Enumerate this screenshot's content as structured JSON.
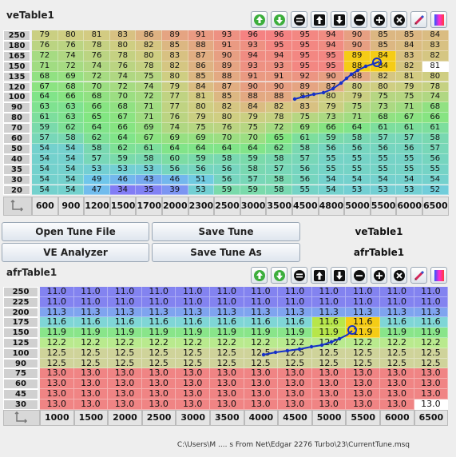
{
  "ve": {
    "title": "veTable1",
    "rpm": [
      "600",
      "900",
      "1200",
      "1500",
      "1700",
      "2000",
      "2300",
      "2500",
      "3000",
      "3500",
      "4500",
      "4800",
      "5000",
      "5500",
      "6000",
      "6500"
    ],
    "load": [
      "250",
      "180",
      "165",
      "150",
      "135",
      "120",
      "100",
      "90",
      "80",
      "70",
      "60",
      "50",
      "40",
      "35",
      "30",
      "20"
    ],
    "rows": [
      [
        "79",
        "80",
        "81",
        "83",
        "86",
        "89",
        "91",
        "93",
        "96",
        "96",
        "95",
        "94",
        "90",
        "85",
        "85",
        "84"
      ],
      [
        "76",
        "76",
        "78",
        "80",
        "82",
        "85",
        "88",
        "91",
        "93",
        "95",
        "95",
        "94",
        "90",
        "85",
        "84",
        "83"
      ],
      [
        "72",
        "74",
        "76",
        "78",
        "80",
        "83",
        "87",
        "90",
        "94",
        "94",
        "95",
        "95",
        "89",
        "84",
        "83",
        "82"
      ],
      [
        "71",
        "72",
        "74",
        "76",
        "78",
        "82",
        "86",
        "89",
        "93",
        "93",
        "95",
        "95",
        "88",
        "84",
        "82",
        "81"
      ],
      [
        "68",
        "69",
        "72",
        "74",
        "75",
        "80",
        "85",
        "88",
        "91",
        "91",
        "92",
        "90",
        "88",
        "82",
        "81",
        "80"
      ],
      [
        "67",
        "68",
        "70",
        "72",
        "74",
        "79",
        "84",
        "87",
        "90",
        "90",
        "89",
        "87",
        "80",
        "80",
        "79",
        "78"
      ],
      [
        "64",
        "66",
        "68",
        "70",
        "72",
        "77",
        "81",
        "85",
        "88",
        "88",
        "83",
        "80",
        "79",
        "75",
        "75",
        "74"
      ],
      [
        "63",
        "63",
        "66",
        "68",
        "71",
        "77",
        "80",
        "82",
        "84",
        "82",
        "83",
        "79",
        "75",
        "73",
        "71",
        "68"
      ],
      [
        "61",
        "63",
        "65",
        "67",
        "71",
        "76",
        "79",
        "80",
        "79",
        "78",
        "75",
        "73",
        "71",
        "68",
        "67",
        "66"
      ],
      [
        "59",
        "62",
        "64",
        "66",
        "69",
        "74",
        "75",
        "76",
        "75",
        "72",
        "69",
        "66",
        "64",
        "61",
        "61",
        "61"
      ],
      [
        "57",
        "58",
        "62",
        "64",
        "67",
        "69",
        "69",
        "70",
        "70",
        "65",
        "61",
        "59",
        "58",
        "57",
        "57",
        "58"
      ],
      [
        "54",
        "54",
        "58",
        "62",
        "61",
        "64",
        "64",
        "64",
        "64",
        "62",
        "58",
        "56",
        "56",
        "56",
        "56",
        "57"
      ],
      [
        "54",
        "54",
        "57",
        "59",
        "58",
        "60",
        "59",
        "58",
        "59",
        "58",
        "57",
        "55",
        "55",
        "55",
        "55",
        "56"
      ],
      [
        "54",
        "54",
        "53",
        "53",
        "53",
        "56",
        "56",
        "56",
        "58",
        "57",
        "56",
        "55",
        "55",
        "55",
        "55",
        "55"
      ],
      [
        "54",
        "54",
        "49",
        "46",
        "43",
        "46",
        "51",
        "56",
        "57",
        "58",
        "56",
        "54",
        "54",
        "54",
        "54",
        "54"
      ],
      [
        "54",
        "54",
        "47",
        "34",
        "35",
        "39",
        "53",
        "59",
        "59",
        "58",
        "55",
        "54",
        "53",
        "53",
        "53",
        "52"
      ]
    ]
  },
  "afr": {
    "title": "afrTable1",
    "rpm": [
      "1000",
      "1500",
      "2000",
      "2500",
      "3000",
      "3500",
      "4000",
      "4500",
      "5000",
      "5500",
      "6000",
      "6500"
    ],
    "load": [
      "250",
      "225",
      "200",
      "175",
      "150",
      "125",
      "100",
      "90",
      "75",
      "60",
      "45",
      "30"
    ],
    "rows": [
      [
        "11.0",
        "11.0",
        "11.0",
        "11.0",
        "11.0",
        "11.0",
        "11.0",
        "11.0",
        "11.0",
        "11.0",
        "11.0",
        "11.0"
      ],
      [
        "11.0",
        "11.0",
        "11.0",
        "11.0",
        "11.0",
        "11.0",
        "11.0",
        "11.0",
        "11.0",
        "11.0",
        "11.0",
        "11.0"
      ],
      [
        "11.3",
        "11.3",
        "11.3",
        "11.3",
        "11.3",
        "11.3",
        "11.3",
        "11.3",
        "11.3",
        "11.3",
        "11.3",
        "11.3"
      ],
      [
        "11.6",
        "11.6",
        "11.6",
        "11.6",
        "11.6",
        "11.6",
        "11.6",
        "11.6",
        "11.6",
        "11.6",
        "11.6",
        "11.6"
      ],
      [
        "11.9",
        "11.9",
        "11.9",
        "11.9",
        "11.9",
        "11.9",
        "11.9",
        "11.9",
        "11.9",
        "11.9",
        "11.9",
        "11.9"
      ],
      [
        "12.2",
        "12.2",
        "12.2",
        "12.2",
        "12.2",
        "12.2",
        "12.2",
        "12.2",
        "12.2",
        "12.2",
        "12.2",
        "12.2"
      ],
      [
        "12.5",
        "12.5",
        "12.5",
        "12.5",
        "12.5",
        "12.5",
        "12.5",
        "12.5",
        "12.5",
        "12.5",
        "12.5",
        "12.5"
      ],
      [
        "12.5",
        "12.5",
        "12.5",
        "12.5",
        "12.5",
        "12.5",
        "12.5",
        "12.5",
        "12.5",
        "12.5",
        "12.5",
        "12.5"
      ],
      [
        "13.0",
        "13.0",
        "13.0",
        "13.0",
        "13.0",
        "13.0",
        "13.0",
        "13.0",
        "13.0",
        "13.0",
        "13.0",
        "13.0"
      ],
      [
        "13.0",
        "13.0",
        "13.0",
        "13.0",
        "13.0",
        "13.0",
        "13.0",
        "13.0",
        "13.0",
        "13.0",
        "13.0",
        "13.0"
      ],
      [
        "13.0",
        "13.0",
        "13.0",
        "13.0",
        "13.0",
        "13.0",
        "13.0",
        "13.0",
        "13.0",
        "13.0",
        "13.0",
        "13.0"
      ],
      [
        "13.0",
        "13.0",
        "13.0",
        "13.0",
        "13.0",
        "13.0",
        "13.0",
        "13.0",
        "13.0",
        "13.0",
        "13.0",
        "13.0"
      ]
    ]
  },
  "toolbar": {
    "icons": [
      "up-arrow-green-icon",
      "down-arrow-green-icon",
      "equals-icon",
      "up-arrow-icon",
      "down-arrow-icon",
      "minus-icon",
      "plus-icon",
      "close-icon",
      "pencil-icon",
      "color-gradient-icon"
    ]
  },
  "buttons": {
    "open_tune": "Open Tune File",
    "save_tune": "Save Tune",
    "ve_analyzer": "VE Analyzer",
    "save_tune_as": "Save Tune As"
  },
  "tabs": {
    "ve": "veTable1",
    "afr": "afrTable1"
  },
  "status": {
    "path": "C:\\Users\\M .... s From Net\\Edgar 2276 Turbo\\23\\CurrentTune.msq"
  },
  "colors": {
    "accent": "#1530c8",
    "highlight": "#f5cc16"
  }
}
